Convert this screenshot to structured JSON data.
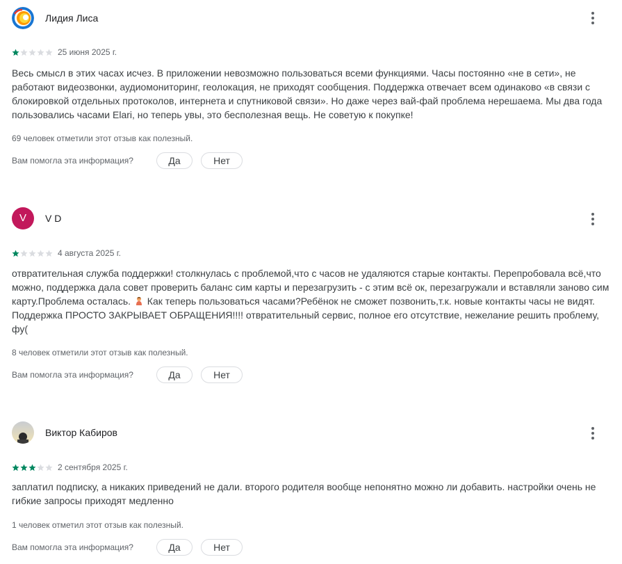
{
  "colors": {
    "star_filled": "#01875f",
    "star_empty": "#dadce0",
    "avatar_vd": "#c2185b",
    "text_secondary": "#5f6368"
  },
  "common": {
    "helpful_question": "Вам помогла эта информация?",
    "yes_label": "Да",
    "no_label": "Нет",
    "more_icon": "more-vert-icon"
  },
  "reviews": [
    {
      "author": "Лидия Лиса",
      "avatar": "photo",
      "rating": 1,
      "date": "25 июня 2025 г.",
      "text": "Весь смысл в этих часах исчез. В приложении невозможно пользоваться всеми функциями. Часы постоянно «не в сети», не работают видеозвонки, аудиомониторинг, геолокация, не приходят сообщения. Поддержка отвечает всем одинаково «в связи с блокировкой отдельных протоколов, интернета и спутниковой связи». Но даже через вай-фай проблема нерешаема. Мы два года пользовались часами Elari, но теперь увы, это бесполезная вещь. Не советую к покупке!",
      "helpful": "69 человек отметили этот отзыв как полезный."
    },
    {
      "author": "V D",
      "avatar_letter": "V",
      "rating": 1,
      "date": "4 августа 2025 г.",
      "text_before_emoji": "отвратительная служба поддержки! столкнулась с проблемой,что с часов не удаляются старые контакты. Перепробовала всё,что можно, поддержка дала совет проверить баланс сим карты и перезагрузить - с этим всё ок, перезагружали и вставляли заново сим карту.Проблема осталась.",
      "emoji": "person-emoji",
      "text_after_emoji": "Как теперь пользоваться часами?Ребёнок не сможет позвонить,т.к. новые контакты часы не видят. Поддержка ПРОСТО ЗАКРЫВАЕТ ОБРАЩЕНИЯ!!!! отвратительный сервис, полное его отсутствие, нежелание решить проблему, фу(",
      "helpful": "8 человек отметили этот отзыв как полезный."
    },
    {
      "author": "Виктор Кабиров",
      "avatar": "photo",
      "rating": 3,
      "date": "2 сентября 2025 г.",
      "text": "заплатил подписку, а никаких приведений не дали. второго родителя вообще непонятно можно ли добавить. настройки очень не гибкие запросы приходят медленно",
      "helpful": "1 человек отметил этот отзыв как полезный."
    }
  ]
}
